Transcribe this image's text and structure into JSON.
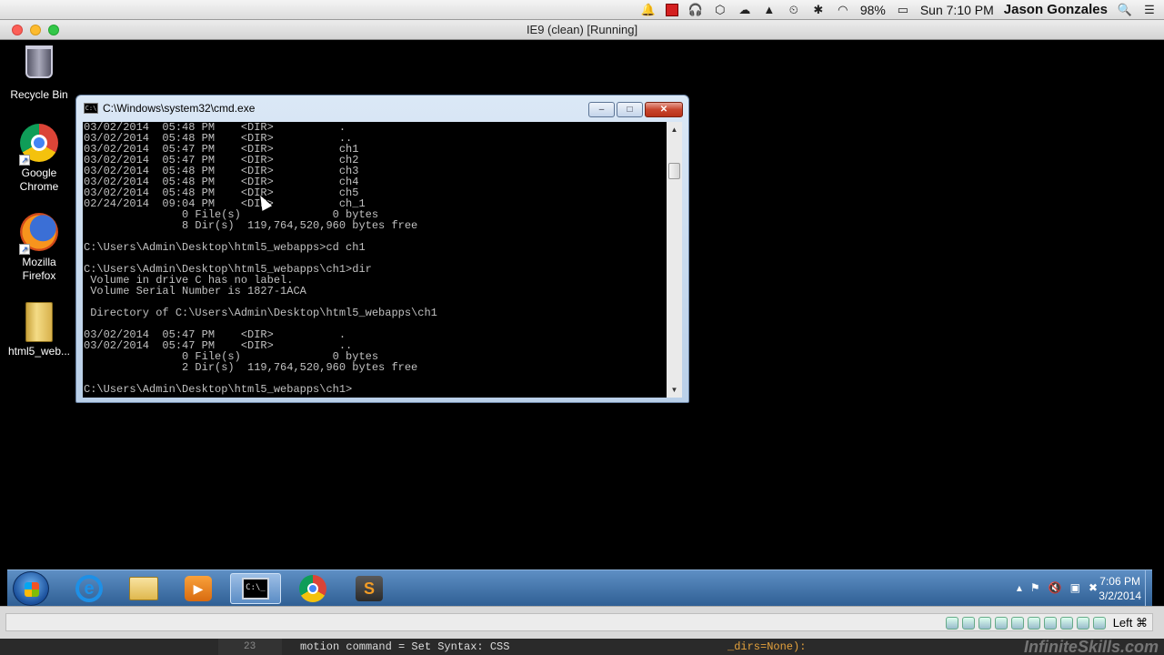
{
  "mac_menubar": {
    "battery": "98%",
    "clock": "Sun 7:10 PM",
    "user": "Jason Gonzales",
    "icons": [
      "bell-icon",
      "red-square-icon",
      "headphones-icon",
      "dropbox-icon",
      "cloud-icon",
      "drive-icon",
      "time-machine-icon",
      "bluetooth-icon",
      "wifi-icon",
      "battery-icon",
      "search-icon",
      "menu-icon"
    ]
  },
  "vm_window": {
    "title": "IE9 (clean) [Running]"
  },
  "desktop_icons": [
    {
      "label": "Recycle Bin"
    },
    {
      "label": "Google Chrome"
    },
    {
      "label": "Mozilla Firefox"
    },
    {
      "label": "html5_web..."
    }
  ],
  "cmd": {
    "title": "C:\\Windows\\system32\\cmd.exe",
    "lines": [
      "03/02/2014  05:48 PM    <DIR>          .",
      "03/02/2014  05:48 PM    <DIR>          ..",
      "03/02/2014  05:47 PM    <DIR>          ch1",
      "03/02/2014  05:47 PM    <DIR>          ch2",
      "03/02/2014  05:48 PM    <DIR>          ch3",
      "03/02/2014  05:48 PM    <DIR>          ch4",
      "03/02/2014  05:48 PM    <DIR>          ch5",
      "02/24/2014  09:04 PM    <DIR>          ch_1",
      "               0 File(s)              0 bytes",
      "               8 Dir(s)  119,764,520,960 bytes free",
      "",
      "C:\\Users\\Admin\\Desktop\\html5_webapps>cd ch1",
      "",
      "C:\\Users\\Admin\\Desktop\\html5_webapps\\ch1>dir",
      " Volume in drive C has no label.",
      " Volume Serial Number is 1827-1ACA",
      "",
      " Directory of C:\\Users\\Admin\\Desktop\\html5_webapps\\ch1",
      "",
      "03/02/2014  05:47 PM    <DIR>          .",
      "03/02/2014  05:47 PM    <DIR>          ..",
      "               0 File(s)              0 bytes",
      "               2 Dir(s)  119,764,520,960 bytes free",
      "",
      "C:\\Users\\Admin\\Desktop\\html5_webapps\\ch1>"
    ]
  },
  "taskbar": {
    "time": "7:06 PM",
    "date": "3/2/2014"
  },
  "vm_status": {
    "host_key": "Left ⌘"
  },
  "editor_peek": {
    "line_number": "23",
    "code": "motion command = Set Syntax: CSS",
    "code_right": "_dirs=None):",
    "watermark": "InfiniteSkills.com"
  }
}
